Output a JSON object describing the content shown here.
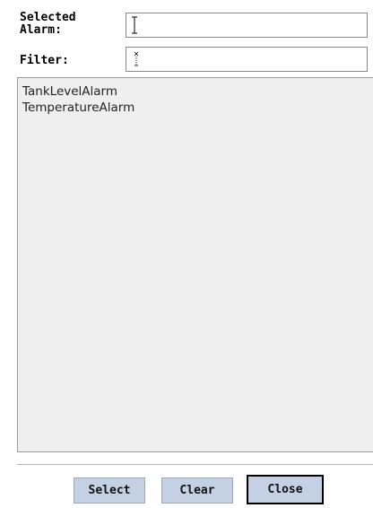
{
  "form": {
    "selected_alarm_label": "Selected\nAlarm:",
    "selected_alarm_value": "",
    "filter_label": "Filter:",
    "filter_value": ""
  },
  "alarm_list": {
    "items": [
      {
        "label": "TankLevelAlarm"
      },
      {
        "label": "TemperatureAlarm"
      }
    ]
  },
  "buttons": {
    "select_label": "Select",
    "clear_label": "Clear",
    "close_label": "Close"
  },
  "colors": {
    "button_fill": "#c4d1e5",
    "list_background": "#efefef"
  },
  "icons": {
    "text_cursor": "i-beam-cursor-icon",
    "filter_cursor": "busy-cursor-icon"
  }
}
